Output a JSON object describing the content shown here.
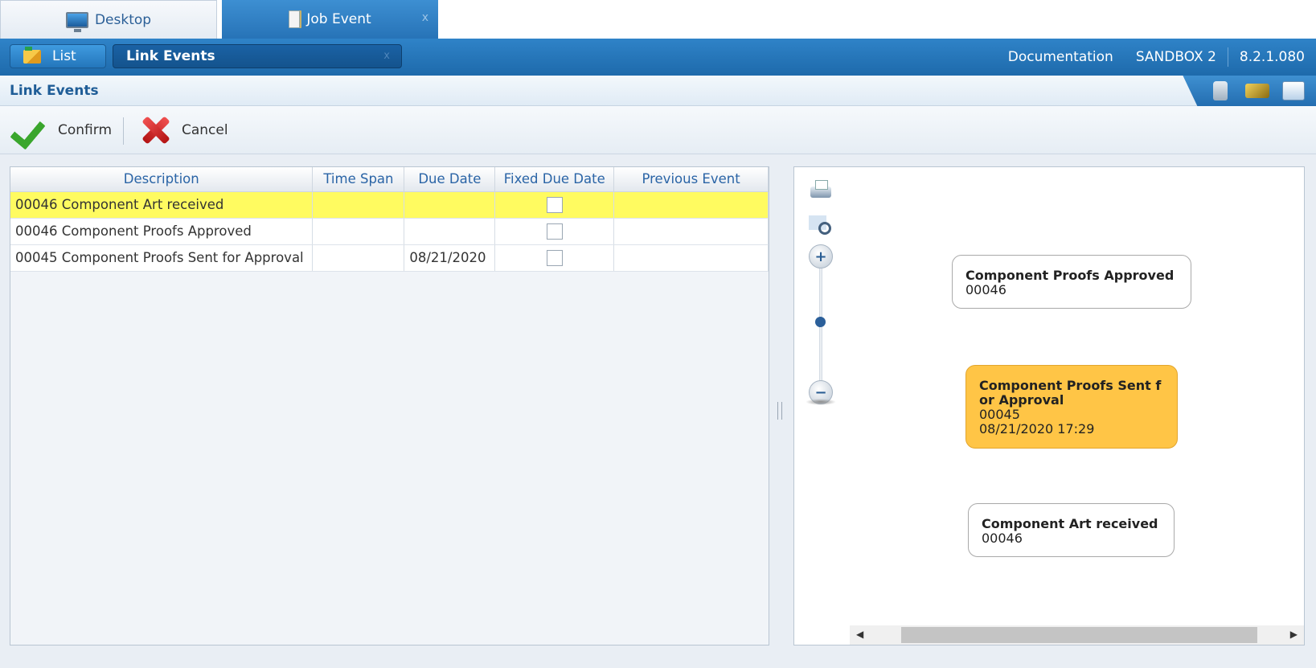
{
  "top_tabs": [
    {
      "label": "Desktop"
    },
    {
      "label": "Job Event",
      "close": "x"
    }
  ],
  "nav": {
    "list_label": "List",
    "link_events_label": "Link Events",
    "link_events_close": "x",
    "documentation": "Documentation",
    "environment": "SANDBOX 2",
    "version": "8.2.1.080"
  },
  "page": {
    "title": "Link Events"
  },
  "toolbar": {
    "confirm_label": "Confirm",
    "cancel_label": "Cancel"
  },
  "grid": {
    "columns": [
      "Description",
      "Time Span",
      "Due Date",
      "Fixed Due Date",
      "Previous Event"
    ],
    "rows": [
      {
        "description": "00046 Component Art received",
        "time_span": "",
        "due_date": "",
        "fixed_due_date": false,
        "previous_event": "",
        "selected": true
      },
      {
        "description": "00046 Component Proofs Approved",
        "time_span": "",
        "due_date": "",
        "fixed_due_date": false,
        "previous_event": "",
        "selected": false
      },
      {
        "description": "00045 Component Proofs Sent for Approval",
        "time_span": "",
        "due_date": "08/21/2020",
        "fixed_due_date": false,
        "previous_event": "",
        "selected": false
      }
    ]
  },
  "diagram": {
    "zoom_in": "+",
    "zoom_out": "−",
    "zoom_level": 0.5,
    "nodes": [
      {
        "title": "Component Proofs Approved",
        "code": "00046",
        "date": ""
      },
      {
        "title": "Component Proofs Sent f or Approval",
        "code": "00045",
        "date": "08/21/2020 17:29",
        "highlight_color": "#ffc546"
      },
      {
        "title": "Component Art received",
        "code": "00046",
        "date": ""
      }
    ],
    "scroll_left": "◀",
    "scroll_right": "▶"
  },
  "colors": {
    "accent": "#2773b7",
    "selected_row": "#fffb60",
    "highlight_node": "#ffc546"
  }
}
